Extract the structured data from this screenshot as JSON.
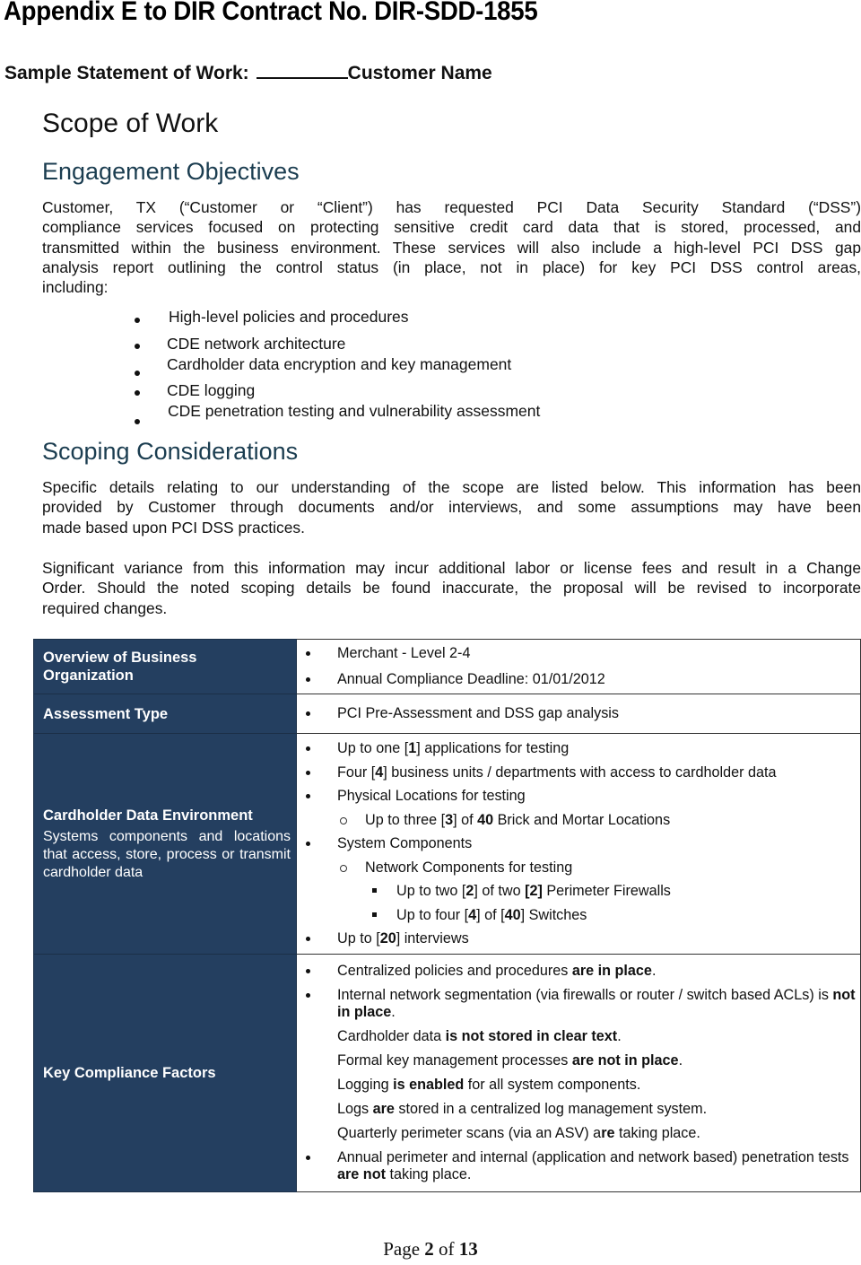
{
  "header": {
    "appendix_title": "Appendix E to DIR Contract No. DIR-SDD-1855",
    "sow_label": "Sample Statement of Work:",
    "customer_name": "Customer Name"
  },
  "scope": {
    "title": "Scope of Work",
    "engagement_heading": "Engagement Objectives",
    "engagement_lines": [
      "Customer, TX (“Customer or “Client”) has requested PCI Data Security Standard (“DSS”)",
      "compliance services focused on protecting sensitive credit card data that is stored, processed, and",
      "transmitted within the business environment.  These services will also include a high-level PCI DSS gap",
      "analysis report outlining the control status (in place, not in place) for key PCI DSS control areas,",
      "including:"
    ],
    "control_areas": [
      "High-level policies and procedures",
      "CDE network architecture",
      "Cardholder data encryption and key management",
      "CDE logging",
      "CDE penetration testing and vulnerability assessment"
    ],
    "scoping_heading": "Scoping Considerations",
    "scoping_para1": [
      "Specific details relating to our understanding of the scope are listed below.  This information has been",
      "provided by Customer through documents and/or interviews, and some assumptions may have been",
      "made based upon PCI DSS practices."
    ],
    "scoping_para2": [
      "Significant variance from this information may incur additional labor or license fees and result in a Change",
      "Order.  Should the noted scoping details be found inaccurate, the proposal will be revised to incorporate",
      "required changes."
    ]
  },
  "table": {
    "rows": [
      {
        "label": "Overview of Business Organization",
        "items": [
          {
            "level": 1,
            "bullet": true,
            "parts": [
              {
                "t": "Merchant - Level 2-4"
              }
            ]
          },
          {
            "level": 1,
            "bullet": true,
            "parts": [
              {
                "t": " Annual Compliance Deadline: 01/01/2012"
              }
            ]
          }
        ]
      },
      {
        "label": "Assessment Type",
        "items": [
          {
            "level": 1,
            "bullet": true,
            "parts": [
              {
                "t": "PCI Pre-Assessment and DSS gap analysis"
              }
            ]
          }
        ]
      },
      {
        "label": "Cardholder Data Environment",
        "description": "Systems components and locations that access, store, process or transmit cardholder data",
        "items": [
          {
            "level": 1,
            "bullet": true,
            "parts": [
              {
                "t": "Up to one ["
              },
              {
                "t": "1",
                "b": true
              },
              {
                "t": "] applications for testing"
              }
            ]
          },
          {
            "level": 1,
            "bullet": true,
            "parts": [
              {
                "t": "Four ["
              },
              {
                "t": "4",
                "b": true
              },
              {
                "t": "] business units / departments with access to cardholder data"
              }
            ]
          },
          {
            "level": 1,
            "bullet": true,
            "parts": [
              {
                "t": "Physical Locations for testing"
              }
            ]
          },
          {
            "level": 2,
            "bullet": true,
            "parts": [
              {
                "t": "Up to three ["
              },
              {
                "t": "3",
                "b": true
              },
              {
                "t": "] of "
              },
              {
                "t": "40",
                "b": true
              },
              {
                "t": " Brick and Mortar Locations"
              }
            ]
          },
          {
            "level": 1,
            "bullet": true,
            "parts": [
              {
                "t": "System Components"
              }
            ]
          },
          {
            "level": 2,
            "bullet": true,
            "parts": [
              {
                "t": "Network Components for testing"
              }
            ]
          },
          {
            "level": 3,
            "bullet": true,
            "parts": [
              {
                "t": "Up to two ["
              },
              {
                "t": "2",
                "b": true
              },
              {
                "t": "] of two "
              },
              {
                "t": "[2]",
                "b": true
              },
              {
                "t": " Perimeter Firewalls"
              }
            ]
          },
          {
            "level": 3,
            "bullet": true,
            "parts": [
              {
                "t": "Up to four ["
              },
              {
                "t": "4",
                "b": true
              },
              {
                "t": "] of ["
              },
              {
                "t": "40",
                "b": true
              },
              {
                "t": "] Switches"
              }
            ]
          },
          {
            "level": 1,
            "bullet": true,
            "parts": [
              {
                "t": "Up to ["
              },
              {
                "t": "20",
                "b": true
              },
              {
                "t": "] interviews"
              }
            ]
          }
        ]
      },
      {
        "label": "Key Compliance Factors",
        "items": [
          {
            "level": 1,
            "bullet": true,
            "parts": [
              {
                "t": "Centralized policies and procedures "
              },
              {
                "t": "are in place",
                "b": true
              },
              {
                "t": "."
              }
            ]
          },
          {
            "level": 1,
            "bullet": true,
            "parts": [
              {
                "t": "Internal network segmentation (via firewalls or router / switch based ACLs) is "
              },
              {
                "t": "not in place",
                "b": true
              },
              {
                "t": "."
              }
            ]
          },
          {
            "level": 1,
            "bullet": false,
            "parts": [
              {
                "t": "Cardholder data "
              },
              {
                "t": "is not stored in clear text",
                "b": true
              },
              {
                "t": "."
              }
            ]
          },
          {
            "level": 1,
            "bullet": false,
            "parts": [
              {
                "t": "Formal key management processes "
              },
              {
                "t": "are not in place",
                "b": true
              },
              {
                "t": "."
              }
            ]
          },
          {
            "level": 1,
            "bullet": false,
            "parts": [
              {
                "t": "Logging "
              },
              {
                "t": "is enabled",
                "b": true
              },
              {
                "t": " for all system components."
              }
            ]
          },
          {
            "level": 1,
            "bullet": false,
            "parts": [
              {
                "t": "Logs "
              },
              {
                "t": "are",
                "b": true
              },
              {
                "t": " stored in a centralized log management system."
              }
            ]
          },
          {
            "level": 1,
            "bullet": false,
            "parts": [
              {
                "t": "Quarterly perimeter scans (via an ASV) a"
              },
              {
                "t": "re",
                "b": true
              },
              {
                "t": " taking place."
              }
            ]
          },
          {
            "level": 1,
            "bullet": true,
            "parts": [
              {
                "t": "Annual perimeter and internal (application and network based) penetration tests "
              },
              {
                "t": "are not",
                "b": true
              },
              {
                "t": " taking place."
              }
            ]
          }
        ]
      }
    ]
  },
  "footer": {
    "page_prefix": "Page ",
    "page_current": "2",
    "page_of": " of ",
    "page_total": "13"
  },
  "colors": {
    "table_label_bg": "#243f60",
    "heading_color": "#1b3d50"
  }
}
